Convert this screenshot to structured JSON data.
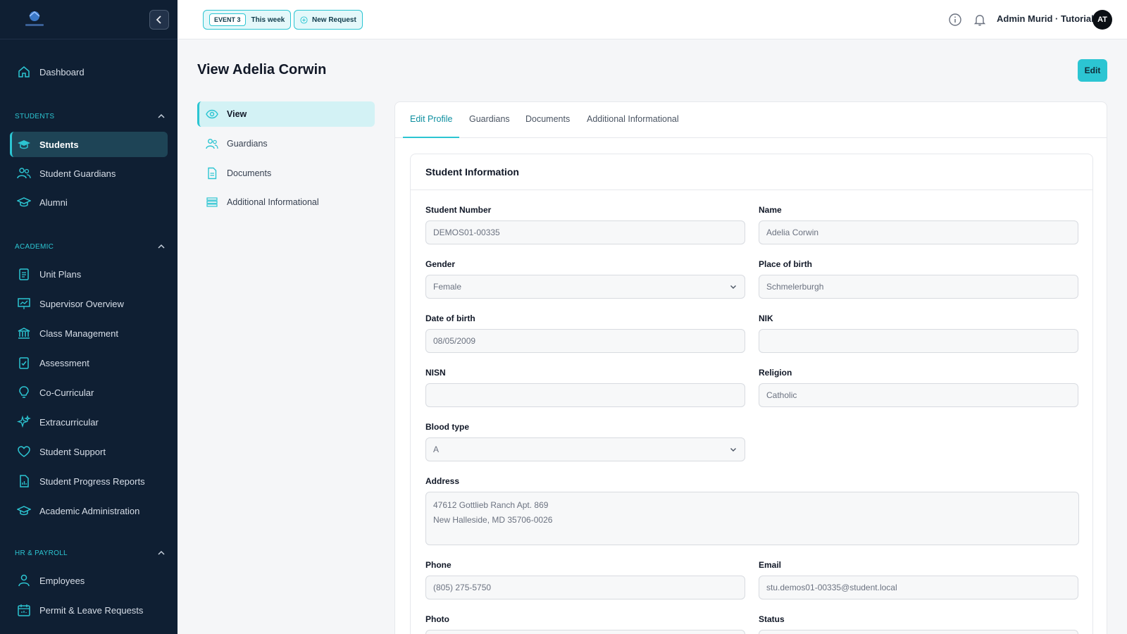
{
  "sidebar": {
    "items": {
      "dashboard": "Dashboard",
      "students": "Students",
      "student_guardians": "Student Guardians",
      "alumni": "Alumni",
      "unit_plans": "Unit Plans",
      "supervisor_overview": "Supervisor Overview",
      "class_management": "Class Management",
      "assessment": "Assessment",
      "co_curricular": "Co-Curricular",
      "extracurricular": "Extracurricular",
      "student_support": "Student Support",
      "student_progress_reports": "Student Progress Reports",
      "academic_administration": "Academic Administration",
      "employees": "Employees",
      "permit_leave": "Permit & Leave Requests"
    },
    "sections": {
      "students": "STUDENTS",
      "academic": "ACADEMIC",
      "hr": "HR & PAYROLL"
    }
  },
  "topbar": {
    "event_tag": "EVENT 3",
    "event_label": "This week",
    "new_request": "New Request",
    "user_name": "Admin Murid · Tutorial",
    "avatar_initials": "AT"
  },
  "page": {
    "title": "View Adelia Corwin",
    "edit_label": "Edit"
  },
  "subnav": {
    "view": "View",
    "guardians": "Guardians",
    "documents": "Documents",
    "additional": "Additional Informational"
  },
  "tabs": {
    "edit_profile": "Edit Profile",
    "guardians": "Guardians",
    "documents": "Documents",
    "additional": "Additional Informational"
  },
  "form": {
    "section_title": "Student Information",
    "student_number": {
      "label": "Student Number",
      "value": "DEMOS01-00335"
    },
    "name": {
      "label": "Name",
      "value": "Adelia Corwin"
    },
    "gender": {
      "label": "Gender",
      "value": "Female"
    },
    "place_of_birth": {
      "label": "Place of birth",
      "value": "Schmelerburgh"
    },
    "date_of_birth": {
      "label": "Date of birth",
      "value": "08/05/2009"
    },
    "nik": {
      "label": "NIK",
      "value": ""
    },
    "nisn": {
      "label": "NISN",
      "value": ""
    },
    "religion": {
      "label": "Religion",
      "value": "Catholic"
    },
    "blood_type": {
      "label": "Blood type",
      "value": "A"
    },
    "address": {
      "label": "Address",
      "line1": "47612 Gottlieb Ranch Apt. 869",
      "line2": "New Halleside, MD 35706-0026"
    },
    "phone": {
      "label": "Phone",
      "value": "(805) 275-5750"
    },
    "email": {
      "label": "Email",
      "value": "stu.demos01-00335@student.local"
    },
    "photo": {
      "label": "Photo"
    },
    "status": {
      "label": "Status"
    }
  },
  "colors": {
    "accent": "#2cc5d2",
    "sidebar_bg": "#0f1f33",
    "active_bg": "#1e4456"
  }
}
